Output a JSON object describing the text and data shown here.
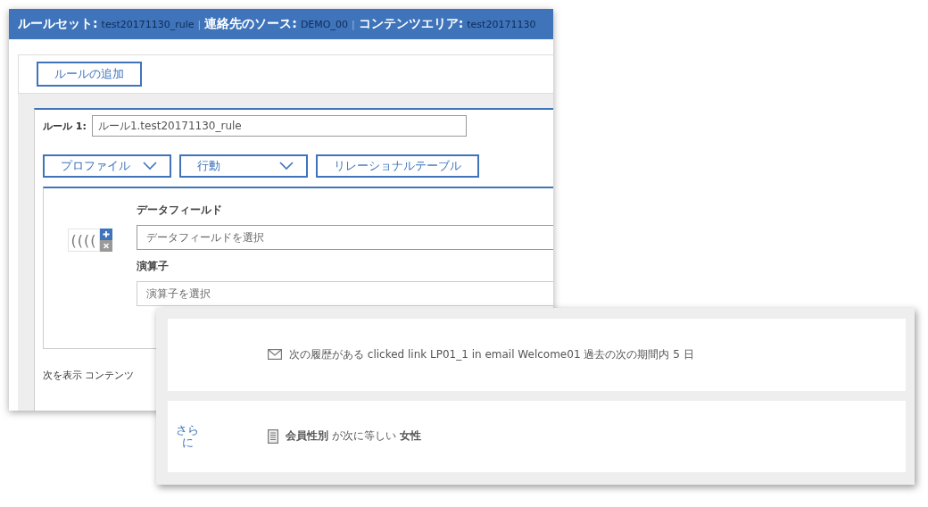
{
  "rule_window": {
    "header": [
      {
        "kind": "label",
        "text": "ルールセット:"
      },
      {
        "kind": "value",
        "text": "test20171130_rule"
      },
      {
        "kind": "separator",
        "text": "|"
      },
      {
        "kind": "label",
        "text": "連絡先のソース:"
      },
      {
        "kind": "value",
        "text": "DEMO_00"
      },
      {
        "kind": "separator",
        "text": "|"
      },
      {
        "kind": "label",
        "text": "コンテンツエリア:"
      },
      {
        "kind": "value",
        "text": "test20171130"
      }
    ],
    "add_rule_button": "ルールの追加",
    "rule": {
      "label": "ルール 1:",
      "name_value": "ルール1.test20171130_rule",
      "buttons": [
        {
          "kind": "dropdown",
          "label": "プロファイル"
        },
        {
          "kind": "dropdown",
          "label": "行動"
        },
        {
          "kind": "plain",
          "label": "リレーショナルテーブル"
        }
      ],
      "condition": {
        "parens": "((((",
        "data_field_label": "データフィールド",
        "data_field_placeholder": "データフィールドを選択",
        "operator_label": "演算子",
        "operator_placeholder": "演算子を選択"
      },
      "footer_text": "次を表示 コンテンツ"
    }
  },
  "summary_card": {
    "rows": [
      {
        "kind": "email",
        "link": null,
        "text": "次の履歴がある clicked link LP01_1 in email Welcome01 過去の次の期間内 5 日"
      },
      {
        "kind": "profile",
        "link": "さらに",
        "text": "**会員性別** が次に等しい **女性**"
      }
    ]
  }
}
